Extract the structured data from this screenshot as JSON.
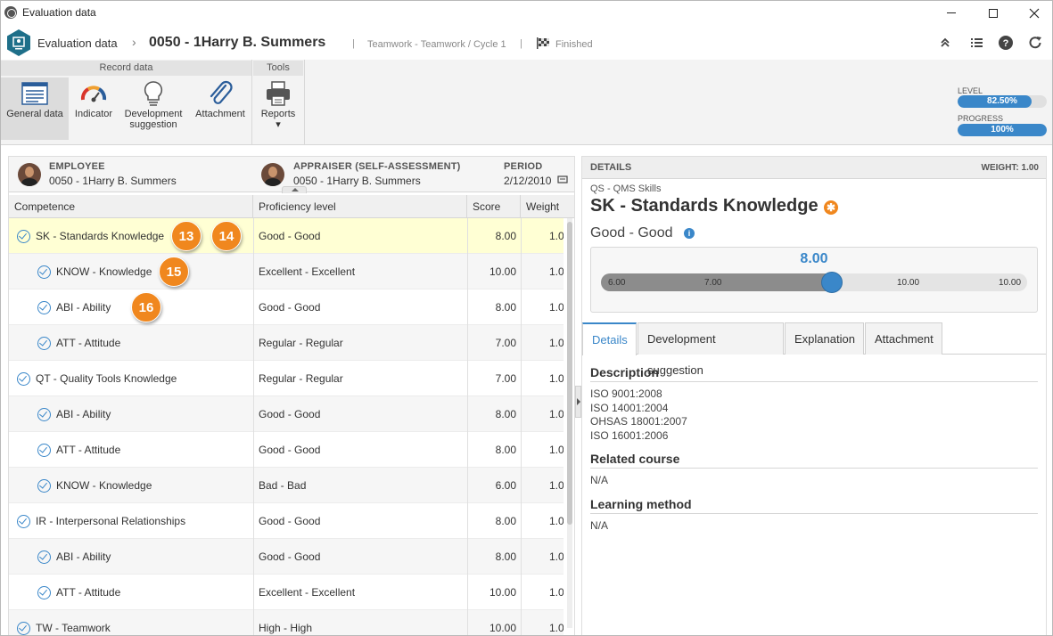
{
  "window": {
    "title": "Evaluation data"
  },
  "header": {
    "breadcrumb": "Evaluation data",
    "record": "0050 - 1Harry B. Summers",
    "team": "Teamwork - Teamwork / Cycle 1",
    "status": "Finished"
  },
  "ribbon": {
    "groups": {
      "record_data": "Record data",
      "tools": "Tools"
    },
    "buttons": {
      "general_data": "General data",
      "indicator": "Indicator",
      "development_1": "Development",
      "development_2": "suggestion",
      "attachment": "Attachment",
      "reports": "Reports"
    },
    "level": {
      "label": "LEVEL",
      "text": "82.50%",
      "value": 0.825
    },
    "progress": {
      "label": "PROGRESS",
      "text": "100%",
      "value": 1.0
    }
  },
  "info": {
    "employee_label": "EMPLOYEE",
    "employee_value": "0050 - 1Harry B. Summers",
    "appraiser_label": "APPRAISER (SELF-ASSESSMENT)",
    "appraiser_value": "0050 - 1Harry B. Summers",
    "period_label": "PERIOD",
    "period_value": "2/12/2010"
  },
  "table": {
    "columns": {
      "competence": "Competence",
      "proficiency": "Proficiency level",
      "score": "Score",
      "weight": "Weight"
    },
    "rows": [
      {
        "competence": "SK - Standards Knowledge",
        "proficiency": "Good - Good",
        "score": "8.00",
        "weight": "1.0",
        "level": 0
      },
      {
        "competence": "KNOW - Knowledge",
        "proficiency": "Excellent - Excellent",
        "score": "10.00",
        "weight": "1.0",
        "level": 1
      },
      {
        "competence": "ABI - Ability",
        "proficiency": "Good - Good",
        "score": "8.00",
        "weight": "1.0",
        "level": 1
      },
      {
        "competence": "ATT - Attitude",
        "proficiency": "Regular - Regular",
        "score": "7.00",
        "weight": "1.0",
        "level": 1
      },
      {
        "competence": "QT - Quality Tools Knowledge",
        "proficiency": "Regular - Regular",
        "score": "7.00",
        "weight": "1.0",
        "level": 0
      },
      {
        "competence": "ABI - Ability",
        "proficiency": "Good - Good",
        "score": "8.00",
        "weight": "1.0",
        "level": 1
      },
      {
        "competence": "ATT - Attitude",
        "proficiency": "Good - Good",
        "score": "8.00",
        "weight": "1.0",
        "level": 1
      },
      {
        "competence": "KNOW - Knowledge",
        "proficiency": "Bad - Bad",
        "score": "6.00",
        "weight": "1.0",
        "level": 1
      },
      {
        "competence": "IR - Interpersonal Relationships",
        "proficiency": "Good - Good",
        "score": "8.00",
        "weight": "1.0",
        "level": 0
      },
      {
        "competence": "ABI - Ability",
        "proficiency": "Good - Good",
        "score": "8.00",
        "weight": "1.0",
        "level": 1
      },
      {
        "competence": "ATT - Attitude",
        "proficiency": "Excellent - Excellent",
        "score": "10.00",
        "weight": "1.0",
        "level": 1
      },
      {
        "competence": "TW - Teamwork",
        "proficiency": "High - High",
        "score": "10.00",
        "weight": "1.0",
        "level": 0
      }
    ],
    "badges": [
      "13",
      "14",
      "15",
      "16"
    ]
  },
  "details": {
    "header": "DETAILS",
    "weight": "WEIGHT: 1.00",
    "subtitle": "QS - QMS Skills",
    "title": "SK - Standards Knowledge",
    "level": "Good - Good",
    "score": "8.00",
    "score_value": 8.0,
    "ticks": [
      "6.00",
      "7.00",
      "10.00",
      "10.00"
    ],
    "tabs": [
      "Details",
      "Development suggestion",
      "Explanation",
      "Attachment"
    ],
    "description_title": "Description",
    "description_lines": [
      "ISO 9001:2008",
      "ISO 14001:2004",
      "OHSAS 18001:2007",
      "ISO 16001:2006"
    ],
    "related_title": "Related course",
    "related_value": "N/A",
    "learning_title": "Learning method",
    "learning_value": "N/A"
  },
  "colors": {
    "accent": "#3a87c9",
    "badge": "#f0871e",
    "selected_row": "#ffffd4"
  }
}
